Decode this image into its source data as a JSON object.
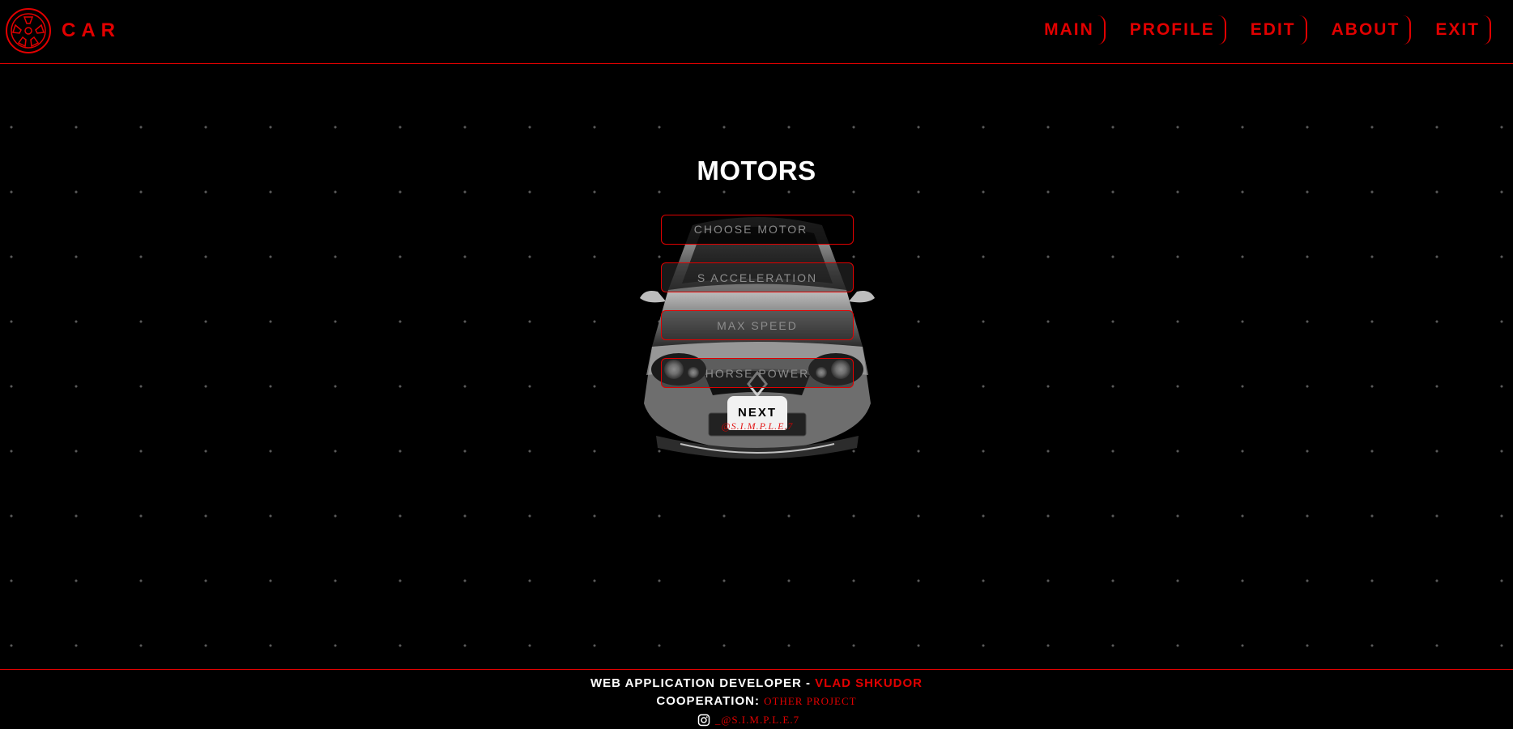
{
  "header": {
    "logo_text": "CAR",
    "nav": [
      {
        "label": "MAIN"
      },
      {
        "label": "PROFILE"
      },
      {
        "label": "EDIT"
      },
      {
        "label": "ABOUT"
      },
      {
        "label": "EXIT"
      }
    ]
  },
  "main": {
    "title": "MOTORS",
    "fields": {
      "choose_motor": "CHOOSE MOTOR",
      "acceleration_placeholder": "S ACCELERATION",
      "max_speed_placeholder": "MAX SPEED",
      "horse_power_placeholder": "HORSE POWER"
    },
    "next_label": "NEXT",
    "watermark": "@S.I.M.P.L.E.7"
  },
  "footer": {
    "developer_prefix": "WEB APPLICATION DEVELOPER - ",
    "developer_name": "VLAD SHKUDOR",
    "cooperation_prefix": "COOPERATION: ",
    "cooperation_link": "OTHER PROJECT",
    "instagram_handle": "_@S.I.M.P.L.E.7"
  },
  "colors": {
    "accent": "#e10000",
    "background": "#000000",
    "text": "#ffffff"
  },
  "icons": {
    "logo": "wheel-icon",
    "instagram": "instagram-icon"
  }
}
